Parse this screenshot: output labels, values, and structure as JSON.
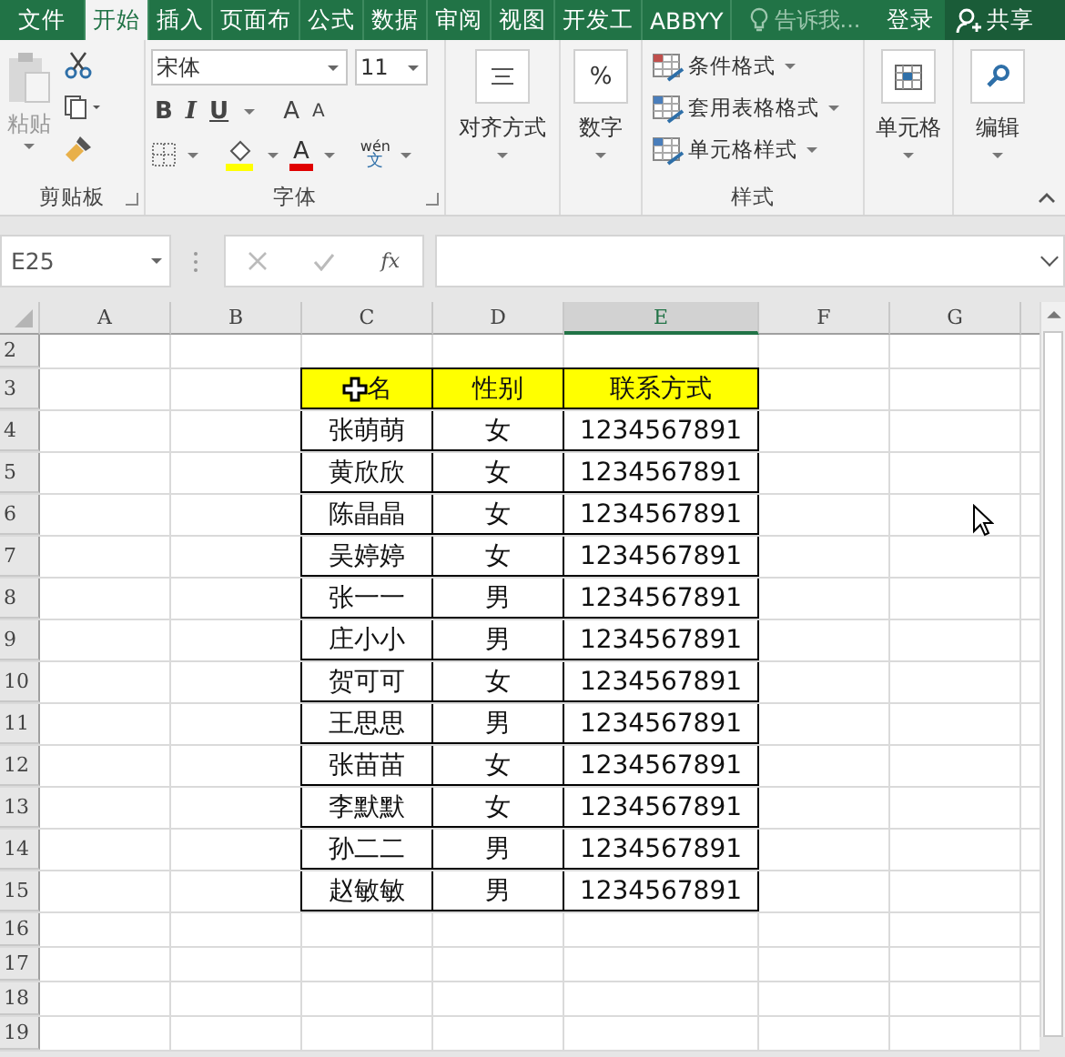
{
  "tabs": [
    {
      "label": "文件",
      "selected": false
    },
    {
      "label": "开始",
      "selected": true
    },
    {
      "label": "插入",
      "selected": false
    },
    {
      "label": "页面布",
      "selected": false
    },
    {
      "label": "公式",
      "selected": false
    },
    {
      "label": "数据",
      "selected": false
    },
    {
      "label": "审阅",
      "selected": false
    },
    {
      "label": "视图",
      "selected": false
    },
    {
      "label": "开发工",
      "selected": false
    },
    {
      "label": "ABBYY",
      "selected": false
    }
  ],
  "tell_me": "告诉我...",
  "sign_in": "登录",
  "share": "共享",
  "ribbon": {
    "clipboard": {
      "paste": "粘贴",
      "label": "剪贴板"
    },
    "font": {
      "name": "宋体",
      "size": "11",
      "bold": "B",
      "italic": "I",
      "underline": "U",
      "grow": "A",
      "shrink": "A",
      "font_color": "A",
      "phonetic_top": "wén",
      "phonetic_bottom": "文",
      "label": "字体"
    },
    "alignment": "对齐方式",
    "number_symbol": "%",
    "number": "数字",
    "styles": {
      "items": [
        "条件格式",
        "套用表格格式",
        "单元格样式"
      ],
      "label": "样式"
    },
    "cells": "单元格",
    "editing": "编辑"
  },
  "formula_bar": {
    "name_box": "E25",
    "fx": "fx"
  },
  "sheet": {
    "columns": [
      {
        "label": "A",
        "selected": false
      },
      {
        "label": "B",
        "selected": false
      },
      {
        "label": "C",
        "selected": false
      },
      {
        "label": "D",
        "selected": false
      },
      {
        "label": "E",
        "selected": true
      },
      {
        "label": "F",
        "selected": false
      },
      {
        "label": "G",
        "selected": false
      }
    ],
    "rows": [
      {
        "number": "2",
        "kind": "empty"
      },
      {
        "number": "3",
        "kind": "header",
        "cells": [
          "名",
          "性别",
          "联系方式"
        ]
      },
      {
        "number": "4",
        "kind": "data",
        "cells": [
          "张萌萌",
          "女",
          "1234567891"
        ]
      },
      {
        "number": "5",
        "kind": "data",
        "cells": [
          "黄欣欣",
          "女",
          "1234567891"
        ]
      },
      {
        "number": "6",
        "kind": "data",
        "cells": [
          "陈晶晶",
          "女",
          "1234567891"
        ]
      },
      {
        "number": "7",
        "kind": "data",
        "cells": [
          "吴婷婷",
          "女",
          "1234567891"
        ]
      },
      {
        "number": "8",
        "kind": "data",
        "cells": [
          "张一一",
          "男",
          "1234567891"
        ]
      },
      {
        "number": "9",
        "kind": "data",
        "cells": [
          "庄小小",
          "男",
          "1234567891"
        ]
      },
      {
        "number": "10",
        "kind": "data",
        "cells": [
          "贺可可",
          "女",
          "1234567891"
        ]
      },
      {
        "number": "11",
        "kind": "data",
        "cells": [
          "王思思",
          "男",
          "1234567891"
        ]
      },
      {
        "number": "12",
        "kind": "data",
        "cells": [
          "张苗苗",
          "女",
          "1234567891"
        ]
      },
      {
        "number": "13",
        "kind": "data",
        "cells": [
          "李默默",
          "女",
          "1234567891"
        ]
      },
      {
        "number": "14",
        "kind": "data",
        "cells": [
          "孙二二",
          "男",
          "1234567891"
        ]
      },
      {
        "number": "15",
        "kind": "data",
        "cells": [
          "赵敏敏",
          "男",
          "1234567891"
        ]
      },
      {
        "number": "16",
        "kind": "empty"
      },
      {
        "number": "17",
        "kind": "empty"
      },
      {
        "number": "18",
        "kind": "empty"
      },
      {
        "number": "19",
        "kind": "empty"
      }
    ]
  }
}
